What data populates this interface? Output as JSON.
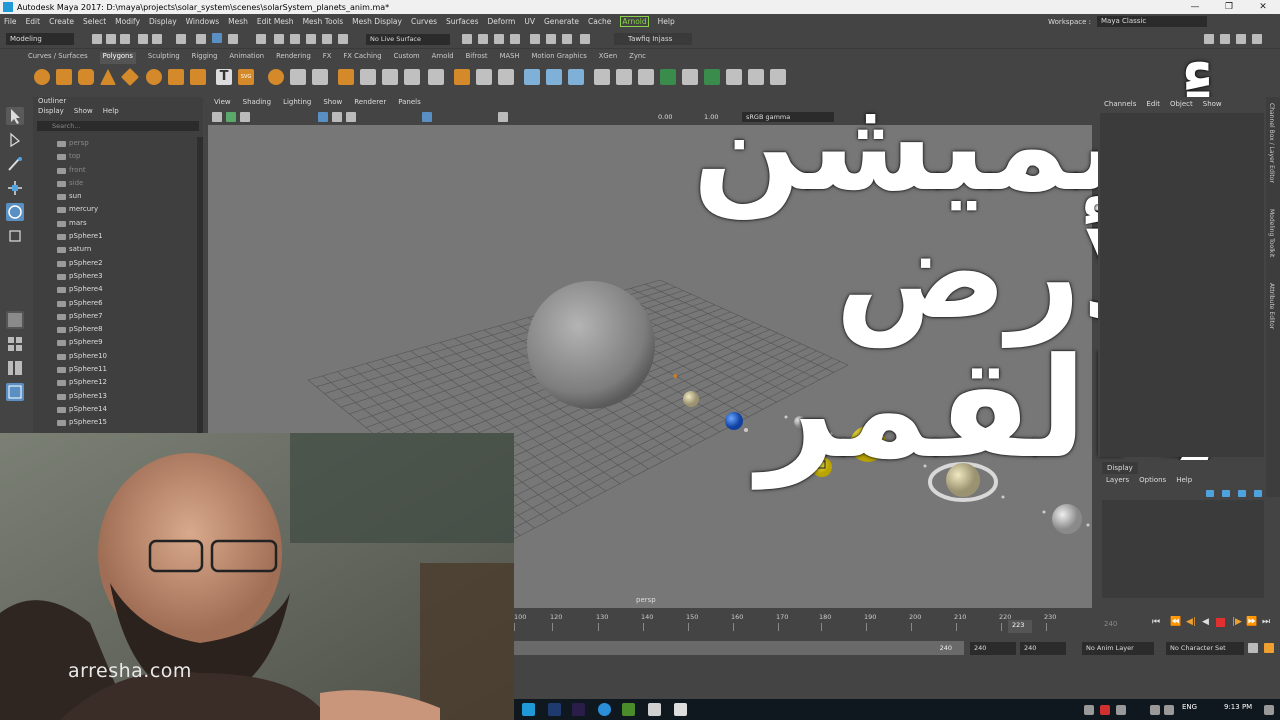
{
  "window": {
    "title": "Autodesk Maya 2017: D:\\maya\\projects\\solar_system\\scenes\\solarSystem_planets_anim.ma*"
  },
  "menu": [
    "File",
    "Edit",
    "Create",
    "Select",
    "Modify",
    "Display",
    "Windows",
    "Mesh",
    "Edit Mesh",
    "Mesh Tools",
    "Mesh Display",
    "Curves",
    "Surfaces",
    "Deform",
    "UV",
    "Generate",
    "Cache",
    "Arnold",
    "Help"
  ],
  "workspace": {
    "label": "Workspace :",
    "value": "Maya Classic"
  },
  "statusline": {
    "mode": "Modeling",
    "live_surface": "No Live Surface",
    "user": "Tawfiq Injass"
  },
  "shelf": {
    "tabs": [
      "Curves / Surfaces",
      "Polygons",
      "Sculpting",
      "Rigging",
      "Animation",
      "Rendering",
      "FX",
      "FX Caching",
      "Custom",
      "Arnold",
      "Bifrost",
      "MASH",
      "Motion Graphics",
      "XGen",
      "Zync"
    ],
    "active": "Polygons"
  },
  "outliner": {
    "title": "Outliner",
    "menu": [
      "Display",
      "Show",
      "Help"
    ],
    "search_placeholder": "Search...",
    "items": [
      "persp",
      "top",
      "front",
      "side",
      "sun",
      "mercury",
      "mars",
      "pSphere1",
      "saturn",
      "pSphere2",
      "pSphere3",
      "pSphere4",
      "pSphere6",
      "pSphere7",
      "pSphere8",
      "pSphere9",
      "pSphere10",
      "pSphere11",
      "pSphere12",
      "pSphere13",
      "pSphere14",
      "pSphere15"
    ]
  },
  "viewport": {
    "menu": [
      "View",
      "Shading",
      "Lighting",
      "Show",
      "Renderer",
      "Panels"
    ],
    "values": [
      "0.00",
      "1.00"
    ],
    "color_space": "sRGB gamma",
    "camera": "persp"
  },
  "overlay": {
    "line1": "أنيميشن الأرض",
    "line2": "والقمر"
  },
  "channel_box": {
    "menu": [
      "Channels",
      "Edit",
      "Object",
      "Show"
    ]
  },
  "side_tabs": [
    "Channel Box / Layer Editor",
    "Modeling Toolkit",
    "Attribute Editor"
  ],
  "layer_editor": {
    "tab": "Display",
    "menu": [
      "Layers",
      "Options",
      "Help"
    ]
  },
  "timeline": {
    "ticks": [
      "100",
      "120",
      "130",
      "140",
      "150",
      "160",
      "170",
      "180",
      "190",
      "200",
      "210",
      "220",
      "230"
    ],
    "current": "223",
    "end_field": "240",
    "range_fields": [
      "240",
      "240",
      "240"
    ],
    "anim_layer": "No Anim Layer",
    "char_set": "No Character Set"
  },
  "watermark": "arresha.com",
  "taskbar": {
    "lang": "ENG",
    "time": "9:13 PM"
  },
  "colors": {
    "viewport_bg": "#777777",
    "grid": "#505050",
    "earth": "#1f6fe0",
    "sun_yellow": "#e6d219",
    "arnold_green": "#8ad14a"
  }
}
